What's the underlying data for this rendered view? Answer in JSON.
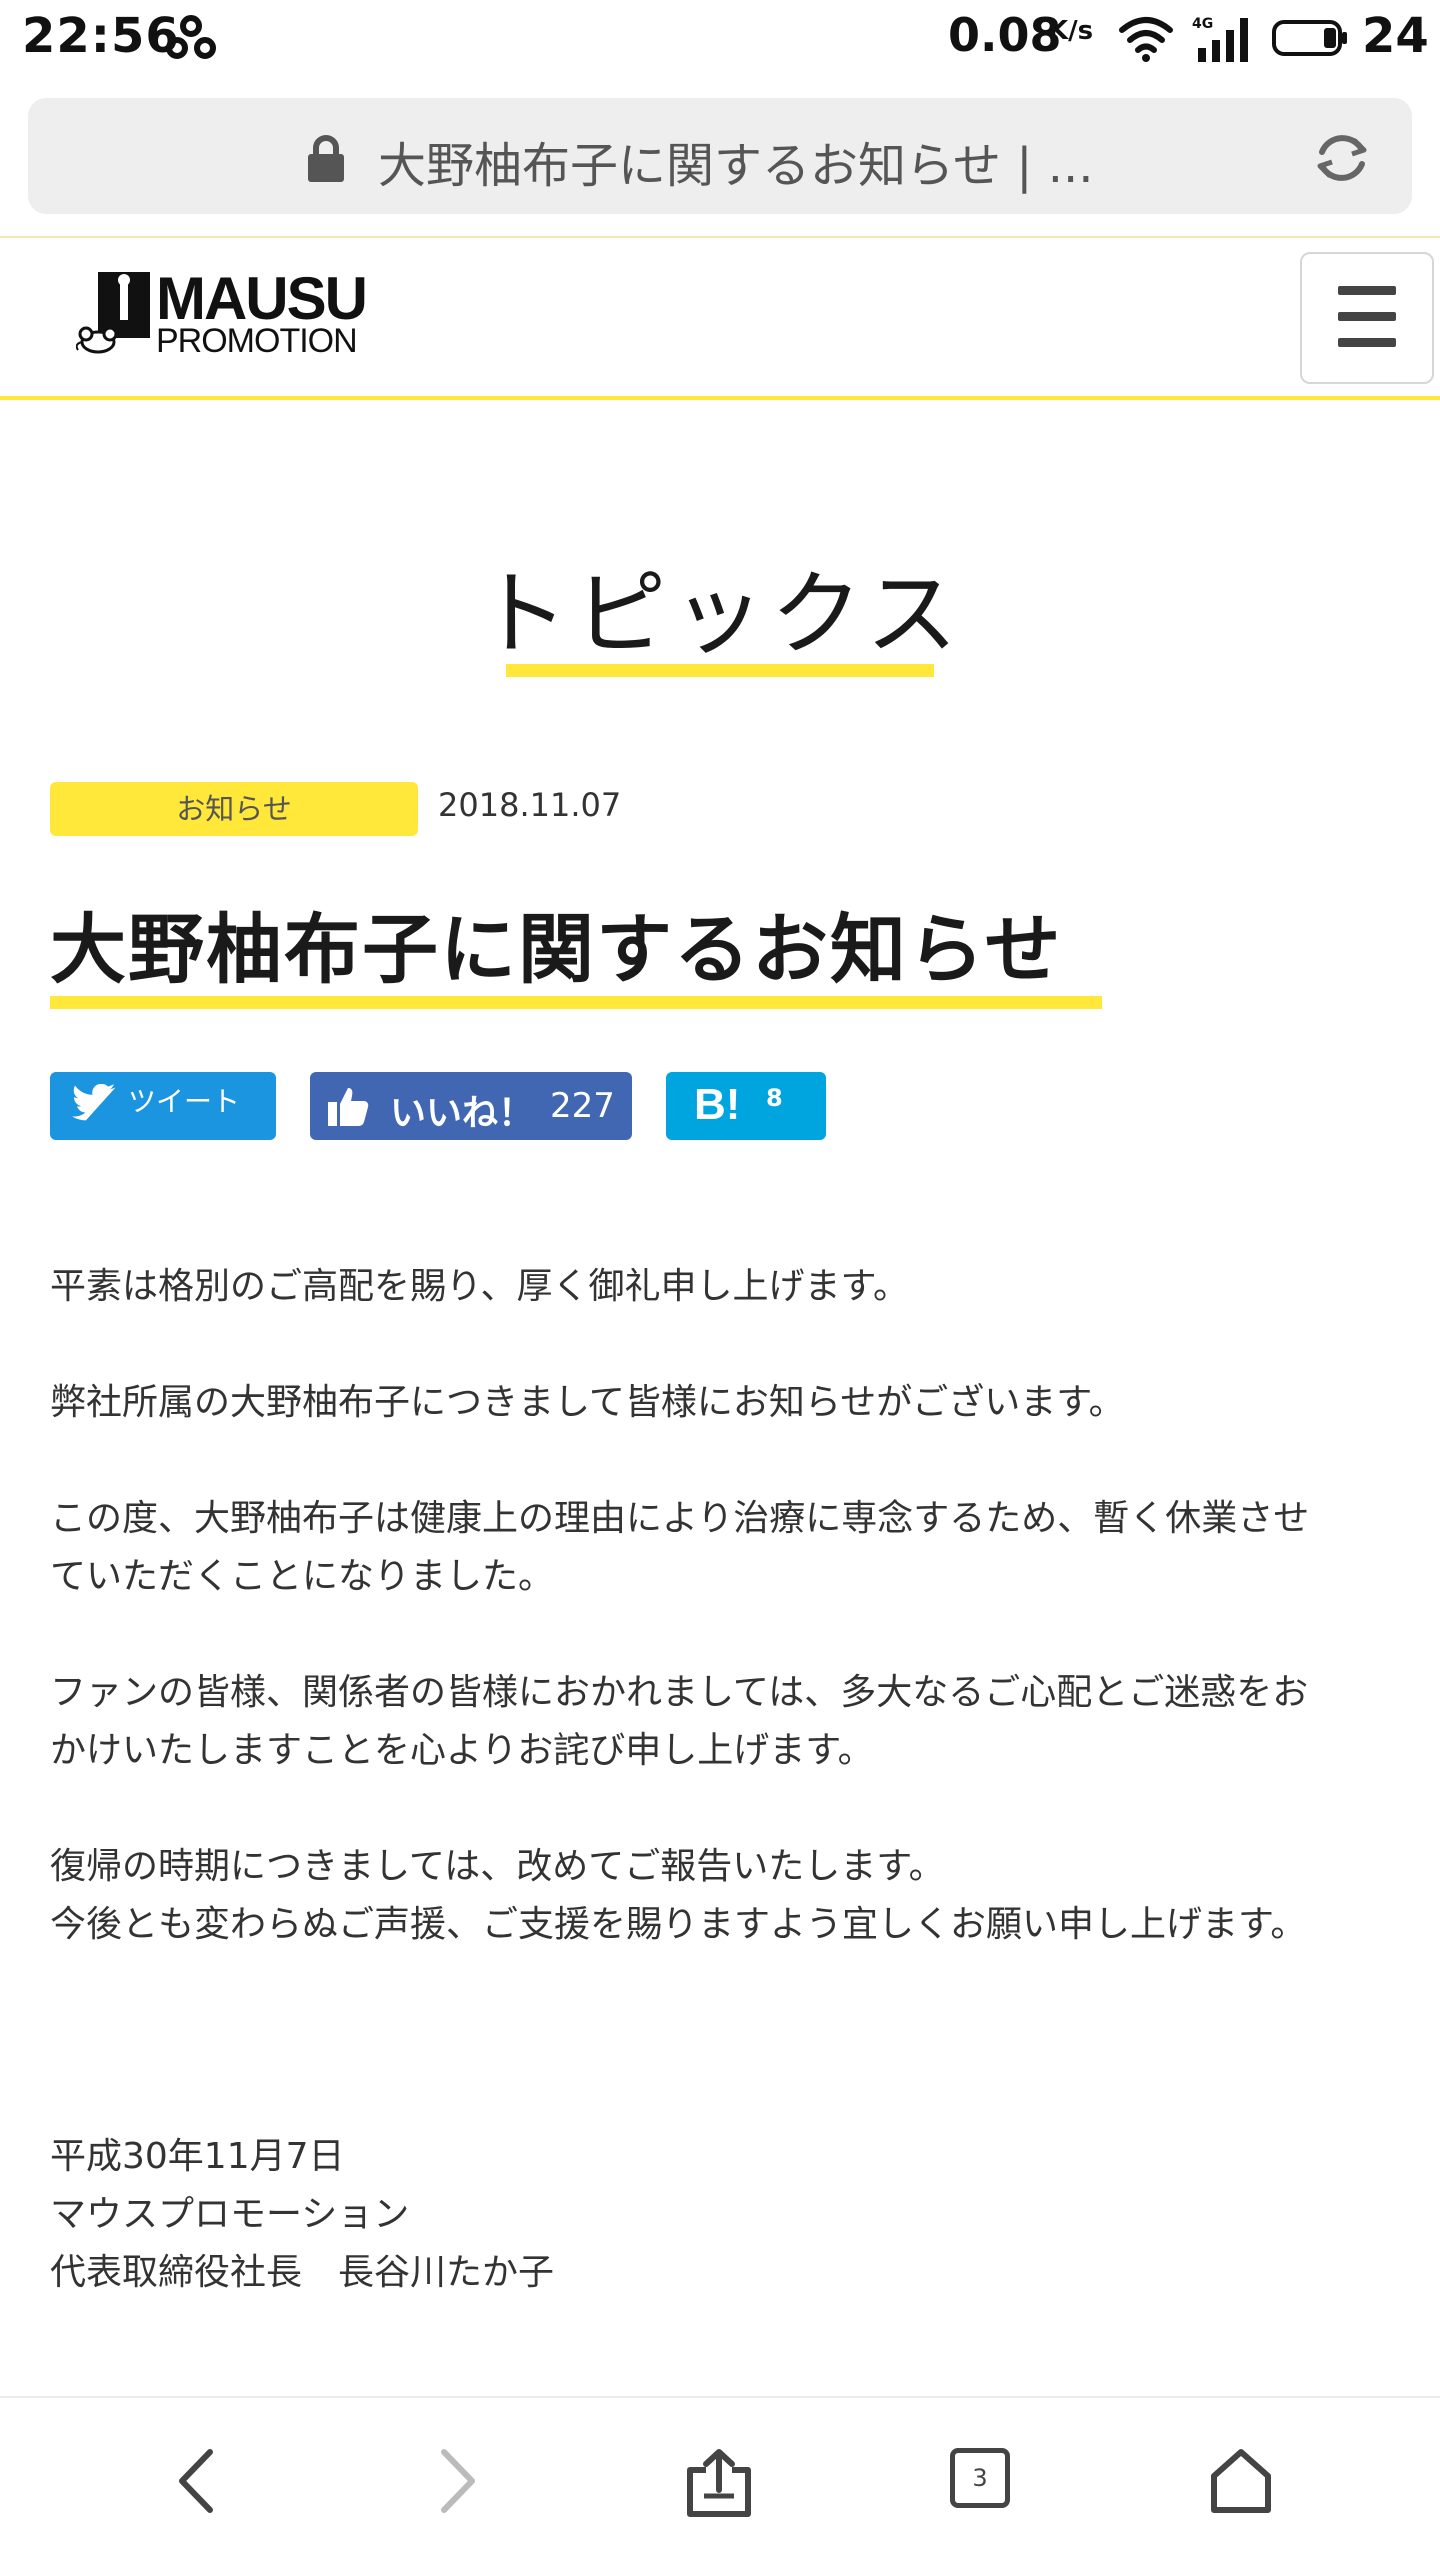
{
  "status_bar": {
    "time": "22:56",
    "speed": "0.08",
    "speed_unit": "K/s",
    "battery_level": "24",
    "network": "4G"
  },
  "browser": {
    "url_title": "大野柚布子に関するお知らせ | ...",
    "tab_count": "3"
  },
  "site": {
    "logo_main": "MAUSU",
    "logo_sub": "PROMOTION"
  },
  "page": {
    "section_title": "トピックス",
    "category": "お知らせ",
    "date": "2018.11.07",
    "article_title": "大野柚布子に関するお知らせ"
  },
  "share": {
    "tweet_label": "ツイート",
    "like_label": "いいね！",
    "like_count": "227",
    "hatena_label": "B!",
    "hatena_count": "8"
  },
  "article": {
    "paragraphs": [
      "平素は格別のご高配を賜り、厚く御礼申し上げます。",
      "弊社所属の大野柚布子につきまして皆様にお知らせがございます。",
      "この度、大野柚布子は健康上の理由により治療に専念するため、暫く休業させ",
      "ていただくことになりました。",
      "ファンの皆様、関係者の皆様におかれましては、多大なるご心配とご迷惑をお",
      "かけいたしますことを心よりお詫び申し上げます。",
      "復帰の時期につきましては、改めてご報告いたします。",
      "今後とも変わらぬご声援、ご支援を賜りますよう宜しくお願い申し上げます。"
    ],
    "signature": [
      "平成30年11月7日",
      "マウスプロモーション",
      "代表取締役社長　長谷川たか子"
    ]
  },
  "colors": {
    "accent_yellow": "#ffe83a",
    "twitter_blue": "#1b95e0",
    "facebook_blue": "#4267b2",
    "hatena_blue": "#00a4de"
  }
}
